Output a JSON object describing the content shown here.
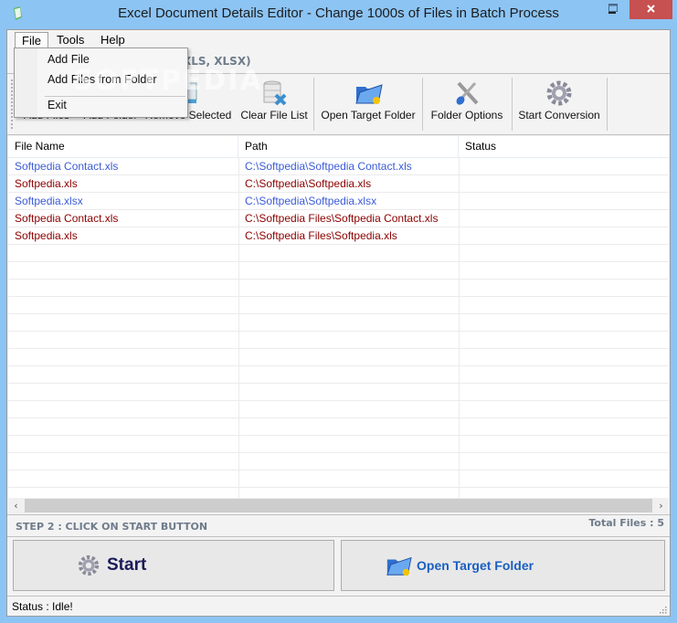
{
  "window": {
    "title": "Excel Document Details Editor - Change 1000s of Files in Batch Process",
    "minimize_glyph": "—",
    "close_glyph": "✕"
  },
  "menubar": {
    "items": [
      {
        "label": "File"
      },
      {
        "label": "Tools"
      },
      {
        "label": "Help"
      }
    ]
  },
  "file_menu": {
    "items": [
      {
        "label": "Add File"
      },
      {
        "label": "Add Files from Folder"
      },
      {
        "label": "Exit"
      }
    ]
  },
  "step1": {
    "visible_text": "XLS, XLSX)"
  },
  "toolbar": {
    "buttons": [
      {
        "label": "Add Files",
        "icon": "add-files-icon"
      },
      {
        "label": "Add Folder",
        "icon": "add-folder-icon"
      },
      {
        "label": "Remove Selected",
        "icon": "remove-icon"
      },
      {
        "label": "Clear File List",
        "icon": "database-clear-icon"
      },
      {
        "label": "Open Target Folder",
        "icon": "open-folder-icon"
      },
      {
        "label": "Folder Options",
        "icon": "tools-icon"
      },
      {
        "label": "Start Conversion",
        "icon": "gear-icon"
      }
    ]
  },
  "grid": {
    "columns": [
      "File Name",
      "Path",
      "Status"
    ],
    "rows": [
      {
        "name": "Softpedia Contact.xls",
        "path": "C:\\Softpedia\\Softpedia Contact.xls",
        "status": "",
        "color": "blue"
      },
      {
        "name": "Softpedia.xls",
        "path": "C:\\Softpedia\\Softpedia.xls",
        "status": "",
        "color": "red"
      },
      {
        "name": "Softpedia.xlsx",
        "path": "C:\\Softpedia\\Softpedia.xlsx",
        "status": "",
        "color": "blue"
      },
      {
        "name": "Softpedia Contact.xls",
        "path": "C:\\Softpedia Files\\Softpedia Contact.xls",
        "status": "",
        "color": "red"
      },
      {
        "name": "Softpedia.xls",
        "path": "C:\\Softpedia Files\\Softpedia.xls",
        "status": "",
        "color": "red"
      }
    ]
  },
  "scrollbar": {
    "left": "‹",
    "right": "›"
  },
  "step2": {
    "label": "STEP 2 : CLICK ON START BUTTON",
    "total_files": "Total Files : 5"
  },
  "actions": {
    "start_label": "Start",
    "open_target_label": "Open Target Folder"
  },
  "status": {
    "text": "Status  :  Idle!"
  },
  "watermark": "SOFTPEDIA",
  "colors": {
    "accent": "#8cc4f4",
    "close": "#c75050",
    "blue_row": "#3b5bd6",
    "red_row": "#8b0000",
    "step_text": "#6e7b8b"
  }
}
